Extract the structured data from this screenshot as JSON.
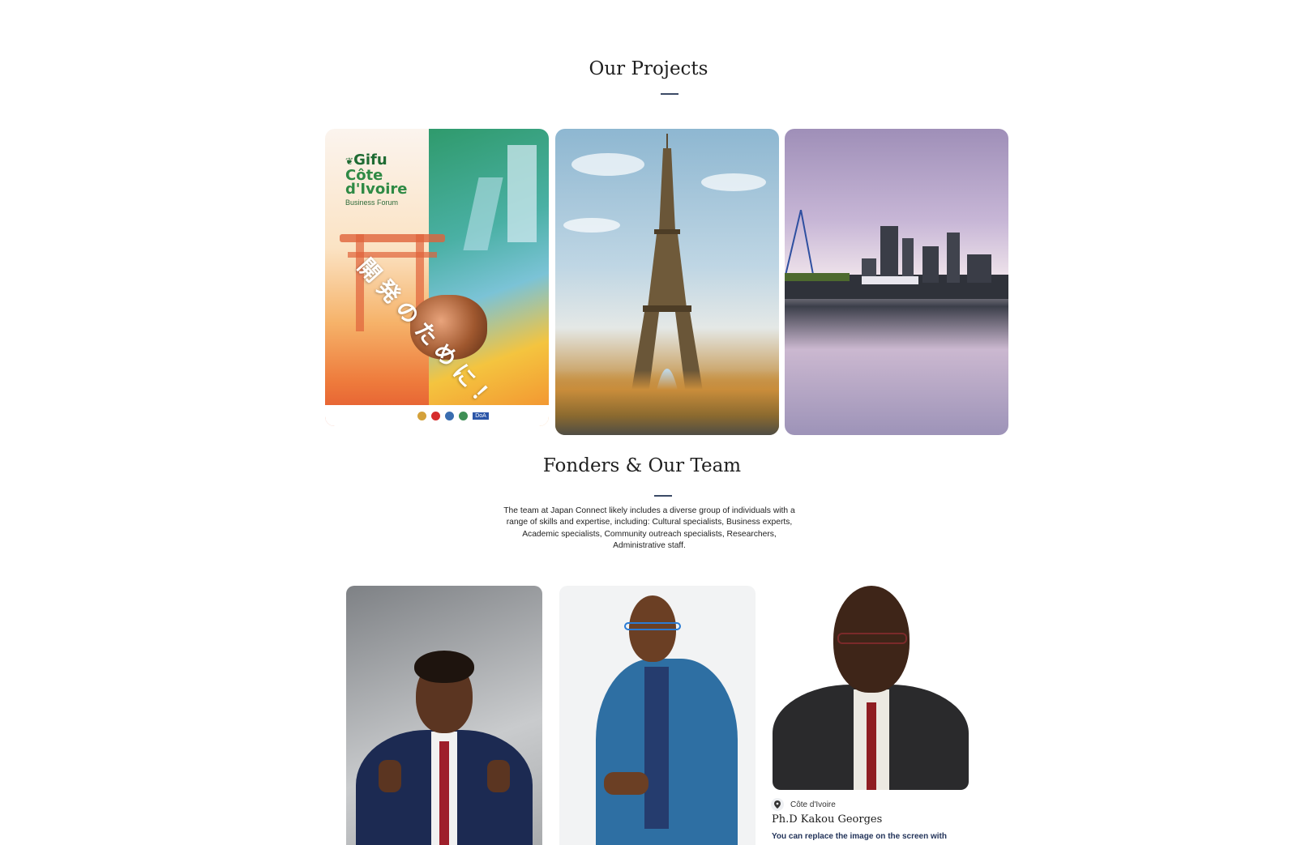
{
  "projects": {
    "title": "Our Projects",
    "cards": [
      {
        "name": "Gifu Côte d'Ivoire Business Forum poster"
      },
      {
        "name": "Eiffel Tower"
      },
      {
        "name": "City skyline reflection"
      }
    ],
    "poster": {
      "logo_line1": "Gifu",
      "logo_line2": "Côte",
      "logo_line3": "d'Ivoire",
      "logo_sub": "Business Forum",
      "japanese": "開発のために！",
      "footer_tag": "DoA"
    }
  },
  "team": {
    "title": "Fonders & Our Team",
    "description": "The team at Japan Connect likely includes a diverse group of individuals with a range of skills and expertise, including: Cultural specialists, Business experts, Academic specialists, Community outreach specialists, Researchers, Administrative staff.",
    "members": [
      {
        "location": "",
        "name": ""
      },
      {
        "location": "",
        "name": ""
      },
      {
        "location": "Côte d'Ivoire",
        "name": "Ph.D Kakou Georges",
        "description": "You can replace the image on the screen with"
      }
    ]
  },
  "colors": {
    "underline": "#3b4a66",
    "name_accent": "#23345a"
  },
  "icons": {
    "location": "map-pin-icon"
  }
}
